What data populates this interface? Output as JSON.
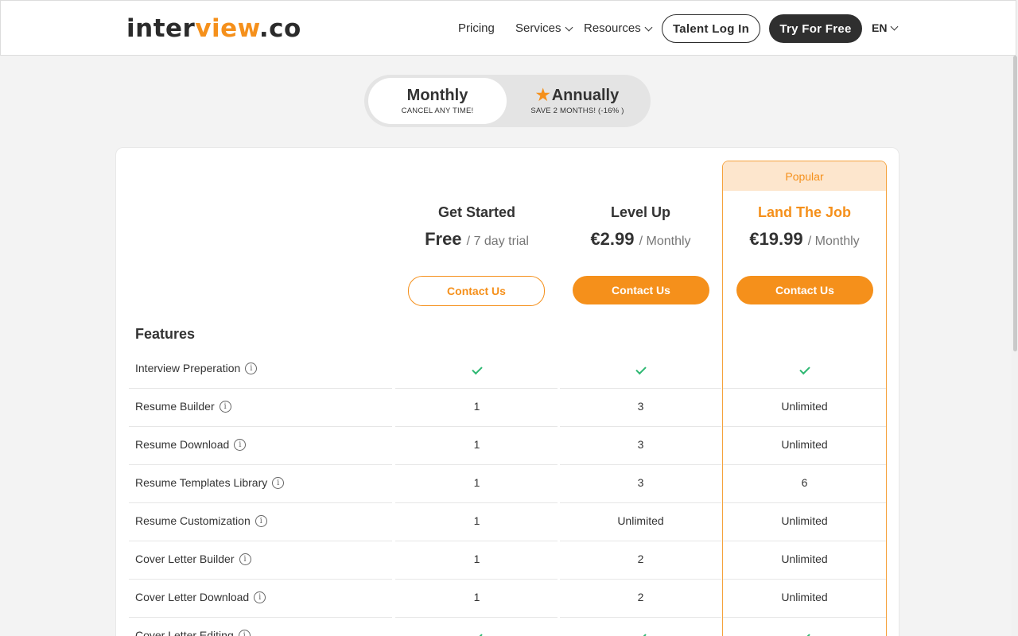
{
  "header": {
    "logo_main": "inter",
    "logo_accent": "view",
    "logo_tld": ".co",
    "nav": {
      "pricing": "Pricing",
      "services": "Services",
      "resources": "Resources"
    },
    "talent_login": "Talent Log In",
    "try_free": "Try For Free",
    "language": "EN"
  },
  "billing_toggle": {
    "monthly_label": "Monthly",
    "monthly_sub": "CANCEL ANY TIME!",
    "annual_label": "Annually",
    "annual_sub": "SAVE 2 MONTHS! (-16% )",
    "selected": "Monthly"
  },
  "plans": [
    {
      "name": "Get Started",
      "price": "Free",
      "period": "/ 7 day trial",
      "cta": "Contact Us",
      "popular": false
    },
    {
      "name": "Level Up",
      "price": "€2.99",
      "period": "/ Monthly",
      "cta": "Contact Us",
      "popular": false
    },
    {
      "name": "Land The Job",
      "price": "€19.99",
      "period": "/ Monthly",
      "cta": "Contact Us",
      "popular": true,
      "badge": "Popular"
    }
  ],
  "features_title": "Features",
  "features": [
    {
      "label": "Interview Preperation",
      "values": [
        "check",
        "check",
        "check"
      ]
    },
    {
      "label": "Resume Builder",
      "values": [
        "1",
        "3",
        "Unlimited"
      ]
    },
    {
      "label": "Resume Download",
      "values": [
        "1",
        "3",
        "Unlimited"
      ]
    },
    {
      "label": "Resume Templates Library",
      "values": [
        "1",
        "3",
        "6"
      ]
    },
    {
      "label": "Resume Customization",
      "values": [
        "1",
        "Unlimited",
        "Unlimited"
      ]
    },
    {
      "label": "Cover Letter Builder",
      "values": [
        "1",
        "2",
        "Unlimited"
      ]
    },
    {
      "label": "Cover Letter Download",
      "values": [
        "1",
        "2",
        "Unlimited"
      ]
    },
    {
      "label": "Cover Letter Editing",
      "values": [
        "check",
        "check",
        "check"
      ]
    }
  ],
  "colors": {
    "accent": "#f5901b",
    "dark": "#2f2f2f",
    "check": "#2eb872",
    "popular_bg": "#fde6cd"
  }
}
